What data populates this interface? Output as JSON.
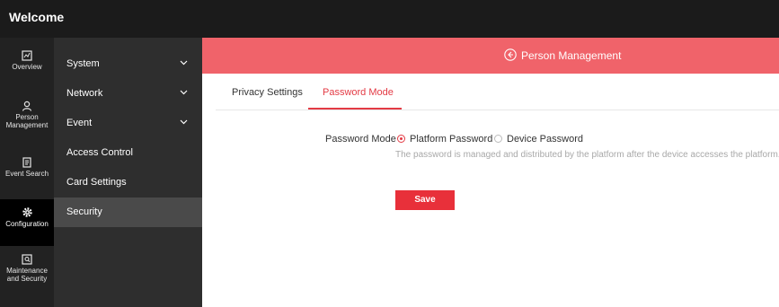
{
  "app": {
    "title": "Welcome"
  },
  "nav": [
    {
      "label": "Overview",
      "icon": "overview-icon"
    },
    {
      "label": "Person Management",
      "icon": "person-icon"
    },
    {
      "label": "Event Search",
      "icon": "event-search-icon"
    },
    {
      "label": "Configuration",
      "icon": "gear-icon",
      "active": true
    },
    {
      "label": "Maintenance and Security",
      "icon": "maintenance-icon"
    }
  ],
  "submenu": [
    {
      "label": "System",
      "expandable": true
    },
    {
      "label": "Network",
      "expandable": true
    },
    {
      "label": "Event",
      "expandable": true
    },
    {
      "label": "Access Control",
      "expandable": false
    },
    {
      "label": "Card Settings",
      "expandable": false
    },
    {
      "label": "Security",
      "expandable": false,
      "active": true
    }
  ],
  "banner": {
    "title": "Person Management"
  },
  "tabs": [
    {
      "label": "Privacy Settings"
    },
    {
      "label": "Password Mode",
      "active": true
    }
  ],
  "form": {
    "password_mode_label": "Password Mode",
    "options": [
      {
        "label": "Platform Password",
        "selected": true
      },
      {
        "label": "Device Password",
        "selected": false
      }
    ],
    "hint": "The password is managed and distributed by the platform after the device accesses the platform.",
    "save_label": "Save"
  },
  "colors": {
    "accent": "#e33a44",
    "banner": "#f0636a",
    "topbar": "#1b1b1b",
    "sidebar": "#222222",
    "submenu": "#2e2e2e"
  }
}
